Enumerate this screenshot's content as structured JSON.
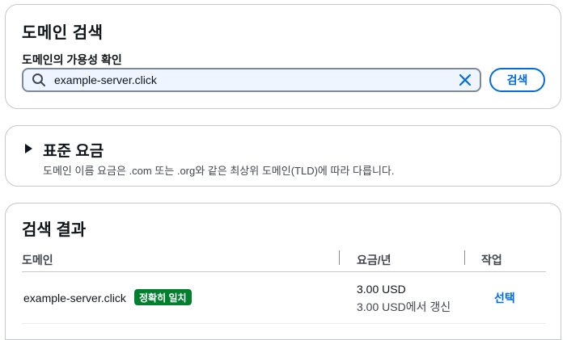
{
  "search_section": {
    "title": "도메인 검색",
    "field_label": "도메인의 가용성 확인",
    "input_value": "example-server.click",
    "search_button": "검색",
    "icons": {
      "search": "search-icon",
      "clear": "close-icon"
    }
  },
  "pricing_section": {
    "title": "표준 요금",
    "description": "도메인 이름 요금은 .com 또는 .org와 같은 최상위 도메인(TLD)에 따라 다릅니다.",
    "expanded": false
  },
  "results_section": {
    "title": "검색 결과",
    "columns": [
      "도메인",
      "요금/년",
      "작업"
    ],
    "rows": [
      {
        "domain": "example-server.click",
        "badge": "정확히 일치",
        "price": "3.00 USD",
        "renewal": "3.00 USD에서 갱신",
        "action": "선택"
      }
    ]
  },
  "colors": {
    "accent": "#006ce0",
    "badge_green": "#00802f",
    "input_bg": "#eef5ff",
    "border": "#c6c6cd"
  }
}
